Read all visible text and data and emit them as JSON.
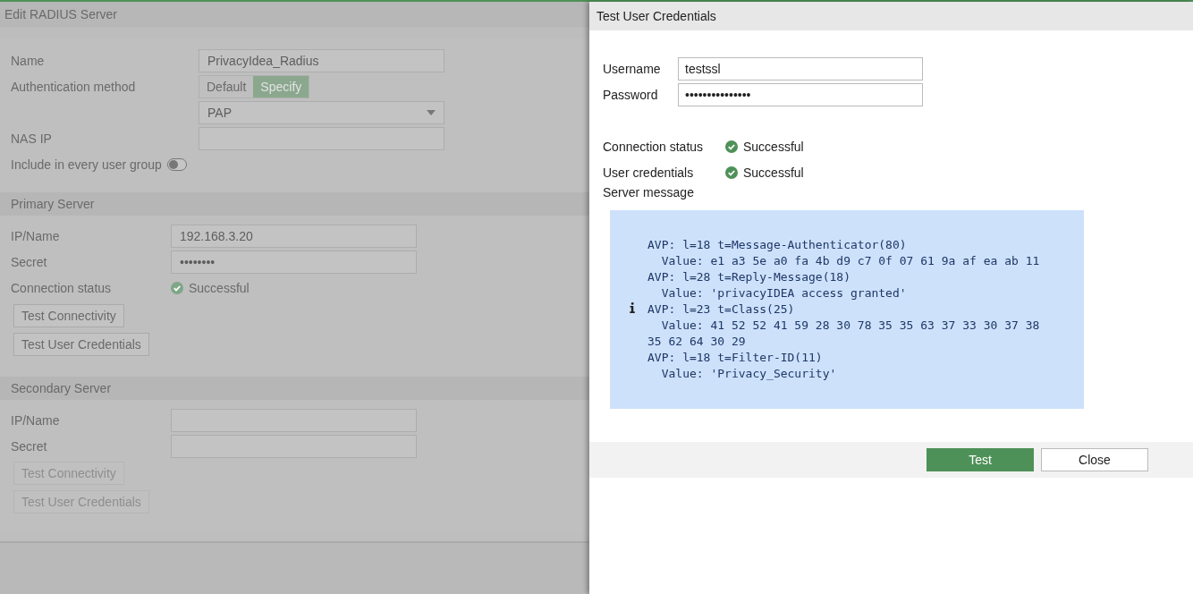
{
  "background_form": {
    "title": "Edit RADIUS Server",
    "fields": [
      {
        "kind": "text",
        "label": "Name",
        "value": "PrivacyIdea_Radius"
      },
      {
        "kind": "segmented",
        "label": "Authentication method",
        "options": [
          {
            "label": "Default",
            "selected": false
          },
          {
            "label": "Specify",
            "selected": true
          }
        ]
      },
      {
        "kind": "select",
        "value": "PAP"
      },
      {
        "kind": "text",
        "label": "NAS IP"
      },
      {
        "kind": "toggle",
        "label": "Include in every user group",
        "on": false
      }
    ],
    "sections": [
      {
        "title": "Primary Server",
        "fields": [
          {
            "label": "IP/Name",
            "value": "192.168.3.20"
          },
          {
            "label": "Secret",
            "value": "••••••••"
          }
        ],
        "status": {
          "label": "Connection status",
          "value": "Successful"
        },
        "buttons": [
          {
            "label": "Test Connectivity",
            "disabled": false
          },
          {
            "label": "Test User Credentials",
            "disabled": false
          }
        ]
      },
      {
        "title": "Secondary Server",
        "fields": [
          {
            "label": "IP/Name"
          },
          {
            "label": "Secret"
          }
        ],
        "buttons": [
          {
            "label": "Test Connectivity",
            "disabled": true
          },
          {
            "label": "Test User Credentials",
            "disabled": true
          }
        ]
      }
    ]
  },
  "dialog": {
    "title": "Test User Credentials",
    "fields": [
      {
        "label": "Username",
        "value": "testssl"
      },
      {
        "label": "Password",
        "value": "•••••••••••••••"
      }
    ],
    "statuses": [
      {
        "label": "Connection status",
        "value": "Successful"
      },
      {
        "label": "User credentials",
        "value": "Successful"
      }
    ],
    "message_label": "Server message",
    "message_lines": [
      "AVP: l=18 t=Message-Authenticator(80)",
      "  Value: e1 a3 5e a0 fa 4b d9 c7 0f 07 61 9a af ea ab 11",
      "AVP: l=28 t=Reply-Message(18)",
      "  Value: 'privacyIDEA access granted'",
      "AVP: l=23 t=Class(25)",
      "  Value: 41 52 52 41 59 28 30 78 35 35 63 37 33 30 37 38",
      "35 62 64 30 29",
      "AVP: l=18 t=Filter-ID(11)",
      "  Value: 'Privacy_Security'"
    ],
    "buttons": [
      {
        "label": "Test",
        "kind": "primary"
      },
      {
        "label": "Close",
        "kind": "secondary"
      }
    ]
  }
}
